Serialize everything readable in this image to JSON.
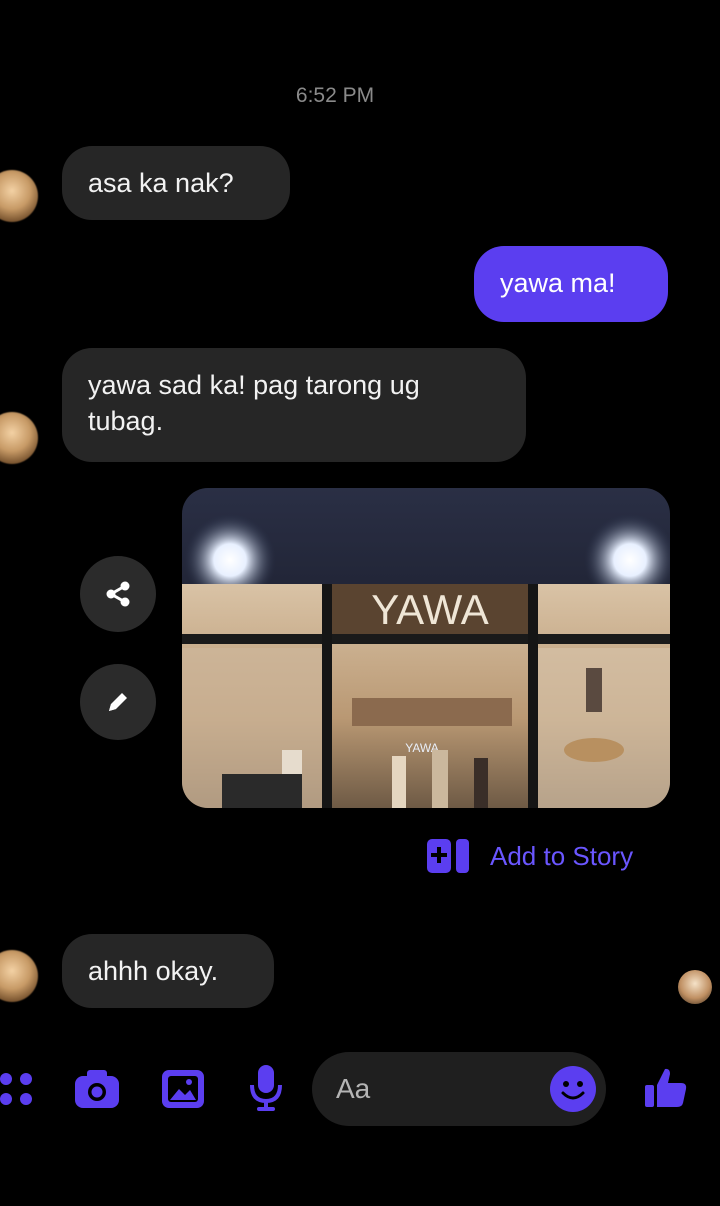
{
  "timestamp": "6:52 PM",
  "messages": [
    {
      "text": "asa ka nak?",
      "direction": "incoming"
    },
    {
      "text": "yawa ma!",
      "direction": "outgoing"
    },
    {
      "text": "yawa sad ka! pag tarong ug tubag.",
      "direction": "incoming"
    },
    {
      "text": "ahhh okay.",
      "direction": "incoming"
    }
  ],
  "photo": {
    "sign_text": "YAWA",
    "inner_sign_text": "YAWA"
  },
  "photo_actions": {
    "share_icon": "share-icon",
    "edit_icon": "pencil-icon"
  },
  "add_to_story": {
    "label": "Add to Story",
    "icon": "add-to-story-icon"
  },
  "composer": {
    "placeholder": "Aa",
    "icons": [
      "apps-icon",
      "camera-icon",
      "gallery-icon",
      "microphone-icon",
      "emoji-icon",
      "thumbs-up-icon"
    ]
  },
  "colors": {
    "accent": "#5b3ef0",
    "incoming_bubble": "#262626",
    "background": "#000000",
    "link": "#6a56ff"
  }
}
